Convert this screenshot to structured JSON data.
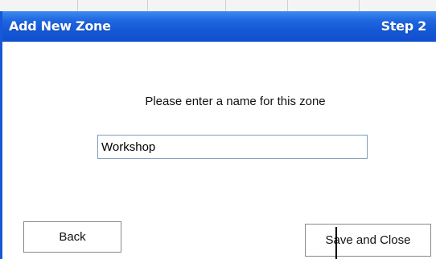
{
  "dialog": {
    "title": "Add New Zone",
    "step_label": "Step 2",
    "prompt": "Please enter a name for this zone",
    "zone_name_value": "Workshop"
  },
  "buttons": {
    "back_label": "Back",
    "save_close_label": "Save and Close"
  },
  "colors": {
    "titlebar_blue": "#1559d6",
    "titlebar_text": "#ffffff",
    "input_border": "#7f9db9"
  }
}
